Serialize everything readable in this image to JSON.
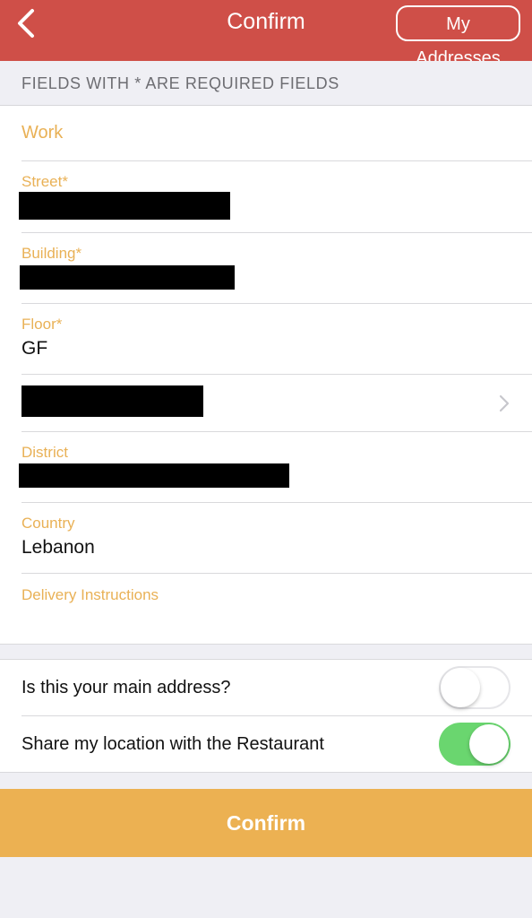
{
  "navbar": {
    "title": "Confirm",
    "my_addresses_label": "My Addresses",
    "back_icon": "chevron-left-icon",
    "color": "#cf4f48"
  },
  "section_header": "FIELDS WITH * ARE REQUIRED FIELDS",
  "form": {
    "address_name": "Work",
    "street": {
      "label": "Street*",
      "value": ""
    },
    "building": {
      "label": "Building*",
      "value": ""
    },
    "floor": {
      "label": "Floor*",
      "value": "GF"
    },
    "area": {
      "value": ""
    },
    "district": {
      "label": "District",
      "value": ""
    },
    "country": {
      "label": "Country",
      "value": "Lebanon"
    },
    "delivery_instructions": {
      "label": "Delivery Instructions",
      "value": ""
    }
  },
  "toggles": {
    "main_address": {
      "label": "Is this your main address?",
      "on": false
    },
    "share_location": {
      "label": "Share my location with the Restaurant",
      "on": true
    }
  },
  "confirm_button": "Confirm",
  "colors": {
    "accent": "#e9b156",
    "button": "#ecb152",
    "switch_on": "#6ad66f"
  }
}
